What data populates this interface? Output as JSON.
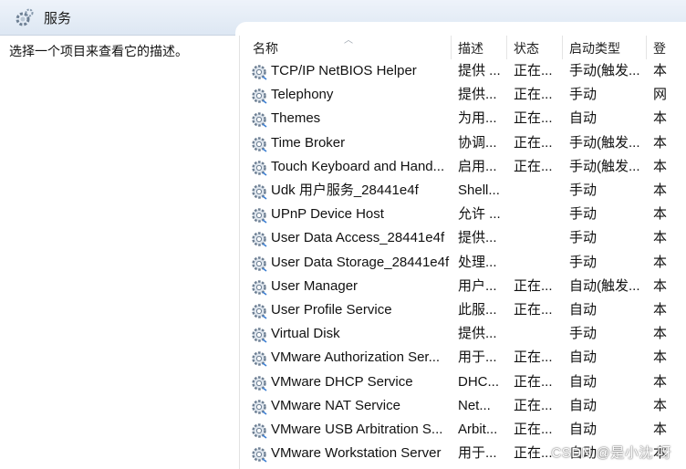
{
  "window": {
    "title": "服务"
  },
  "left_pane": {
    "description": "选择一个项目来查看它的描述。"
  },
  "columns": [
    "名称",
    "描述",
    "状态",
    "启动类型",
    "登"
  ],
  "rows": [
    {
      "name": "TCP/IP NetBIOS Helper",
      "desc": "提供 ...",
      "status": "正在...",
      "startup": "手动(触发...",
      "logon": "本"
    },
    {
      "name": "Telephony",
      "desc": "提供...",
      "status": "正在...",
      "startup": "手动",
      "logon": "网"
    },
    {
      "name": "Themes",
      "desc": "为用...",
      "status": "正在...",
      "startup": "自动",
      "logon": "本"
    },
    {
      "name": "Time Broker",
      "desc": "协调...",
      "status": "正在...",
      "startup": "手动(触发...",
      "logon": "本"
    },
    {
      "name": "Touch Keyboard and Hand...",
      "desc": "启用...",
      "status": "正在...",
      "startup": "手动(触发...",
      "logon": "本"
    },
    {
      "name": "Udk 用户服务_28441e4f",
      "desc": "Shell...",
      "status": "",
      "startup": "手动",
      "logon": "本"
    },
    {
      "name": "UPnP Device Host",
      "desc": "允许 ...",
      "status": "",
      "startup": "手动",
      "logon": "本"
    },
    {
      "name": "User Data Access_28441e4f",
      "desc": "提供...",
      "status": "",
      "startup": "手动",
      "logon": "本"
    },
    {
      "name": "User Data Storage_28441e4f",
      "desc": "处理...",
      "status": "",
      "startup": "手动",
      "logon": "本"
    },
    {
      "name": "User Manager",
      "desc": "用户...",
      "status": "正在...",
      "startup": "自动(触发...",
      "logon": "本"
    },
    {
      "name": "User Profile Service",
      "desc": "此服...",
      "status": "正在...",
      "startup": "自动",
      "logon": "本"
    },
    {
      "name": "Virtual Disk",
      "desc": "提供...",
      "status": "",
      "startup": "手动",
      "logon": "本"
    },
    {
      "name": "VMware Authorization Ser...",
      "desc": "用于...",
      "status": "正在...",
      "startup": "自动",
      "logon": "本"
    },
    {
      "name": "VMware DHCP Service",
      "desc": "DHC...",
      "status": "正在...",
      "startup": "自动",
      "logon": "本"
    },
    {
      "name": "VMware NAT Service",
      "desc": "Net...",
      "status": "正在...",
      "startup": "自动",
      "logon": "本"
    },
    {
      "name": "VMware USB Arbitration S...",
      "desc": "Arbit...",
      "status": "正在...",
      "startup": "自动",
      "logon": "本"
    },
    {
      "name": "VMware Workstation Server",
      "desc": "用于...",
      "status": "正在...",
      "startup": "自动",
      "logon": "本"
    }
  ],
  "watermark": "CSDN @是小沈 呀",
  "colors": {
    "header_bg": "#e6eef8",
    "gear": "#6d7f93",
    "gear_accent": "#3d7fd1"
  },
  "icons": {
    "header": "services-gear-icon",
    "row": "service-gear-icon"
  }
}
